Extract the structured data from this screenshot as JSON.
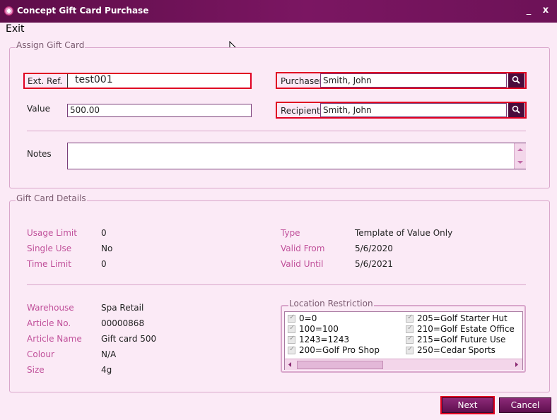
{
  "window": {
    "title": "Concept Gift Card Purchase",
    "minimize_glyph": "_",
    "close_glyph": "x"
  },
  "menu": {
    "exit": "Exit"
  },
  "assign": {
    "group_title": "Assign Gift Card",
    "ext_ref_label": "Ext. Ref.",
    "ext_ref_value": "test001",
    "purchaser_label": "Purchaser",
    "purchaser_value": "Smith, John",
    "value_label": "Value",
    "value_value": "500.00",
    "recipient_label": "Recipient",
    "recipient_value": "Smith, John",
    "notes_label": "Notes",
    "notes_value": ""
  },
  "details": {
    "group_title": "Gift Card Details",
    "usage_limit_label": "Usage Limit",
    "usage_limit_value": "0",
    "single_use_label": "Single Use",
    "single_use_value": "No",
    "time_limit_label": "Time Limit",
    "time_limit_value": "0",
    "type_label": "Type",
    "type_value": "Template of Value Only",
    "valid_from_label": "Valid From",
    "valid_from_value": "5/6/2020",
    "valid_until_label": "Valid Until",
    "valid_until_value": "5/6/2021",
    "warehouse_label": "Warehouse",
    "warehouse_value": "Spa Retail",
    "article_no_label": "Article No.",
    "article_no_value": "00000868",
    "article_name_label": "Article Name",
    "article_name_value": "Gift card 500",
    "colour_label": "Colour",
    "colour_value": "N/A",
    "size_label": "Size",
    "size_value": "4g"
  },
  "location_restriction": {
    "title": "Location Restriction",
    "items": [
      "0=0",
      "100=100",
      "1243=1243",
      "200=Golf Pro Shop",
      "205=Golf Starter Hut",
      "210=Golf Estate Office",
      "215=Golf Future Use",
      "250=Cedar Sports"
    ]
  },
  "buttons": {
    "next": "Next",
    "cancel": "Cancel"
  },
  "colors": {
    "titlebar": "#6d1257",
    "highlight": "#e00022",
    "accent": "#7b1662"
  }
}
